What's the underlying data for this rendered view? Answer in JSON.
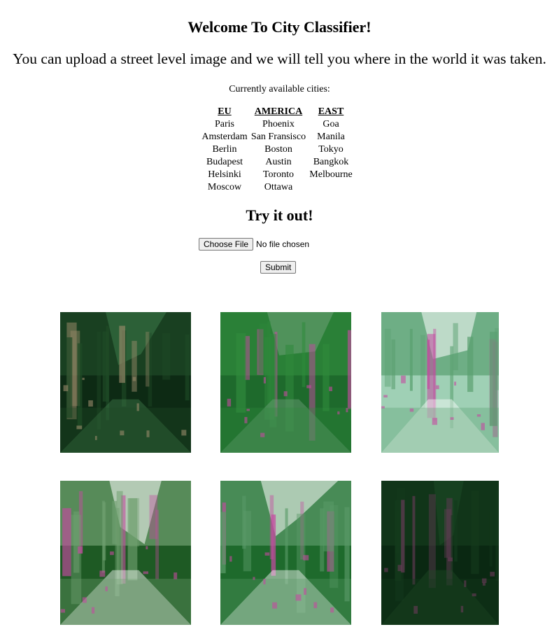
{
  "header": {
    "title": "Welcome To City Classifier!",
    "subtitle": "You can upload a street level image and we will tell you where in the world it was taken."
  },
  "cities": {
    "label": "Currently available cities:",
    "columns": [
      {
        "name": "EU",
        "items": [
          "Paris",
          "Amsterdam",
          "Berlin",
          "Budapest",
          "Helsinki",
          "Moscow"
        ]
      },
      {
        "name": "AMERICA",
        "items": [
          "Phoenix",
          "San Fransisco",
          "Boston",
          "Austin",
          "Toronto",
          "Ottawa"
        ]
      },
      {
        "name": "EAST",
        "items": [
          "Goa",
          "Manila",
          "Tokyo",
          "Bangkok",
          "Melbourne"
        ]
      }
    ]
  },
  "upload": {
    "heading": "Try it out!",
    "choose_label": "Choose File",
    "no_file_text": "No file chosen",
    "submit_label": "Submit"
  },
  "gallery": {
    "images": [
      {
        "name": "generated-street-image-1",
        "palette": [
          "#0d2a14",
          "#1f4a26",
          "#3d7a4a",
          "#9a8a6a"
        ]
      },
      {
        "name": "generated-street-image-2",
        "palette": [
          "#1e6a2c",
          "#2f8a3c",
          "#6fa07a",
          "#c44aa0"
        ]
      },
      {
        "name": "generated-street-image-3",
        "palette": [
          "#9fd0b5",
          "#5aa070",
          "#ffffff",
          "#c44aa0"
        ]
      },
      {
        "name": "generated-street-image-4",
        "palette": [
          "#1e5a24",
          "#6fa070",
          "#ffffff",
          "#c44aa0"
        ]
      },
      {
        "name": "generated-street-image-5",
        "palette": [
          "#1e6a2c",
          "#5a9a68",
          "#ffffff",
          "#c44aa0"
        ]
      },
      {
        "name": "generated-street-image-6",
        "palette": [
          "#0a2812",
          "#143a1c",
          "#1e4a26",
          "#6a3a5a"
        ]
      }
    ]
  }
}
